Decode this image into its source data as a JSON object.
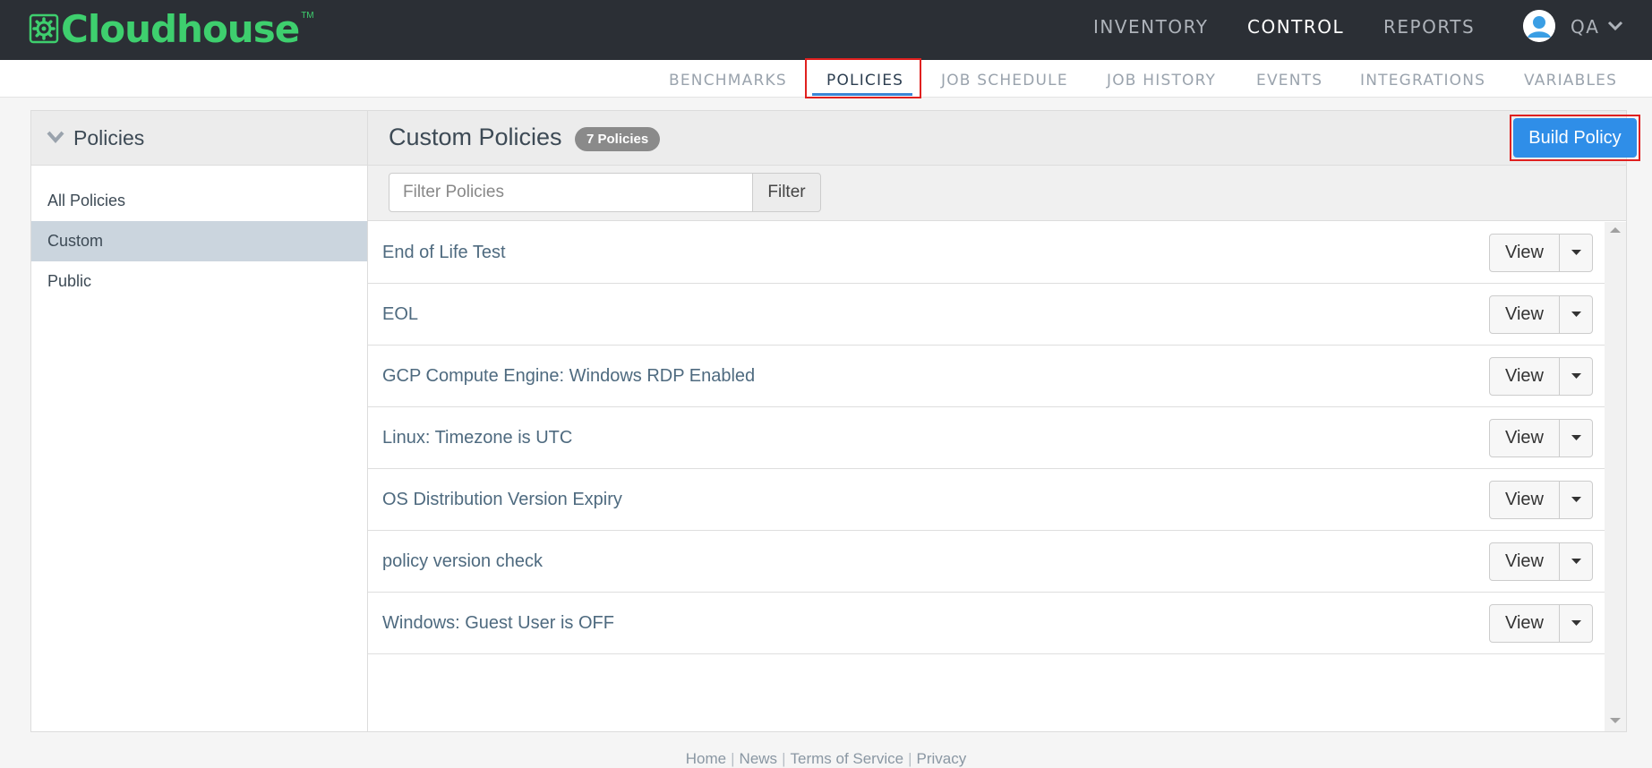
{
  "app": {
    "logo_text": "Cloudhouse",
    "logo_tm": "TM"
  },
  "top_nav": {
    "items": [
      {
        "label": "INVENTORY",
        "active": false
      },
      {
        "label": "CONTROL",
        "active": true
      },
      {
        "label": "REPORTS",
        "active": false
      }
    ],
    "user_label": "QA"
  },
  "sub_nav": {
    "items": [
      {
        "label": "BENCHMARKS",
        "active": false
      },
      {
        "label": "POLICIES",
        "active": true
      },
      {
        "label": "JOB SCHEDULE",
        "active": false
      },
      {
        "label": "JOB HISTORY",
        "active": false
      },
      {
        "label": "EVENTS",
        "active": false
      },
      {
        "label": "INTEGRATIONS",
        "active": false
      },
      {
        "label": "VARIABLES",
        "active": false
      }
    ]
  },
  "sidebar": {
    "title": "Policies",
    "items": [
      {
        "label": "All Policies",
        "active": false
      },
      {
        "label": "Custom",
        "active": true
      },
      {
        "label": "Public",
        "active": false
      }
    ]
  },
  "content": {
    "title": "Custom Policies",
    "count_badge": "7 Policies",
    "build_button": "Build Policy",
    "filter": {
      "placeholder": "Filter Policies",
      "value": "",
      "button": "Filter"
    },
    "view_label": "View",
    "policies": [
      "End of Life Test",
      "EOL",
      "GCP Compute Engine: Windows RDP Enabled",
      "Linux: Timezone is UTC",
      "OS Distribution Version Expiry",
      "policy version check",
      "Windows: Guest User is OFF"
    ]
  },
  "footer": {
    "links": [
      "Home",
      "News",
      "Terms of Service",
      "Privacy"
    ],
    "separator": "|"
  },
  "colors": {
    "topbar_bg": "#2b2f35",
    "logo_green": "#3ecf6e",
    "primary_button": "#2f8ee8",
    "active_tab_underline": "#3a86d6",
    "highlight_box": "#e0201f",
    "sidebar_active_bg": "#cbd5de"
  }
}
